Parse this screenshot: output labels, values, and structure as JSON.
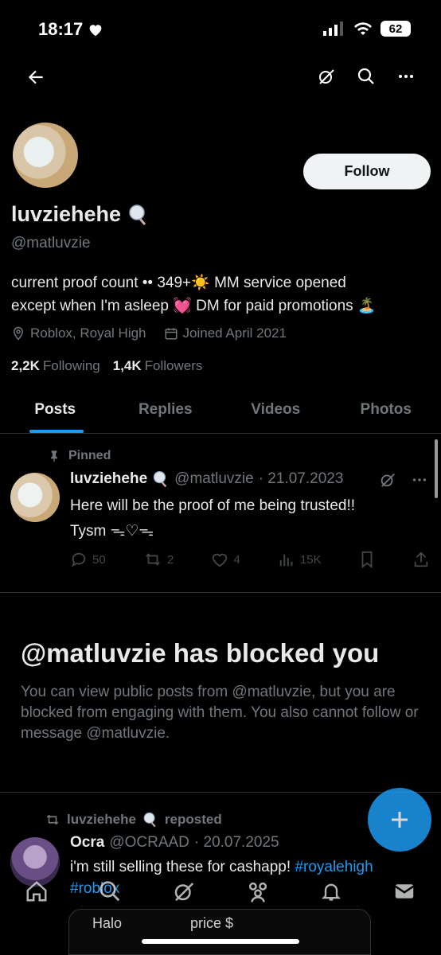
{
  "status": {
    "time": "18:17",
    "battery": "62"
  },
  "profile": {
    "display_name": "luvziehehe",
    "handle": "@matluvzie",
    "follow_label": "Follow",
    "bio_line1": "current proof count •• 349+☀️ MM service opened",
    "bio_line2": "except when I'm asleep 💓 DM for paid promotions 🏝️",
    "location": "Roblox, Royal High",
    "joined": "Joined April 2021",
    "following_count": "2,2K",
    "following_label": "Following",
    "followers_count": "1,4K",
    "followers_label": "Followers"
  },
  "tabs": [
    {
      "label": "Posts"
    },
    {
      "label": "Replies"
    },
    {
      "label": "Videos"
    },
    {
      "label": "Photos"
    }
  ],
  "pinned_post": {
    "pinned_label": "Pinned",
    "name": "luvziehehe",
    "handle": "@matluvzie",
    "date": "· 21.07.2023",
    "text_line1": "Here will be the proof of me being trusted!!",
    "text_line2": "Tysm ᯓ♡ᯓ",
    "replies": "50",
    "reposts": "2",
    "likes": "4",
    "views": "15K"
  },
  "blocked": {
    "title": "@matluvzie has blocked you",
    "body": "You can view public posts from @matluvzie, but you are blocked from engaging with them. You also cannot follow or message @matluvzie."
  },
  "repost": {
    "repost_by": "luvziehehe",
    "repost_label": "reposted",
    "name": "Ocra",
    "handle": "@OCRAAD",
    "date": "· 20.07.2025",
    "text": "i'm still selling these for cashapp!",
    "tag1": "#royalehigh",
    "tag2": "#roblox"
  },
  "strip": {
    "left": "Halo",
    "right": "price $"
  },
  "colors": {
    "accent": "#1d9bf0",
    "background": "#000000",
    "muted": "#71767b"
  }
}
